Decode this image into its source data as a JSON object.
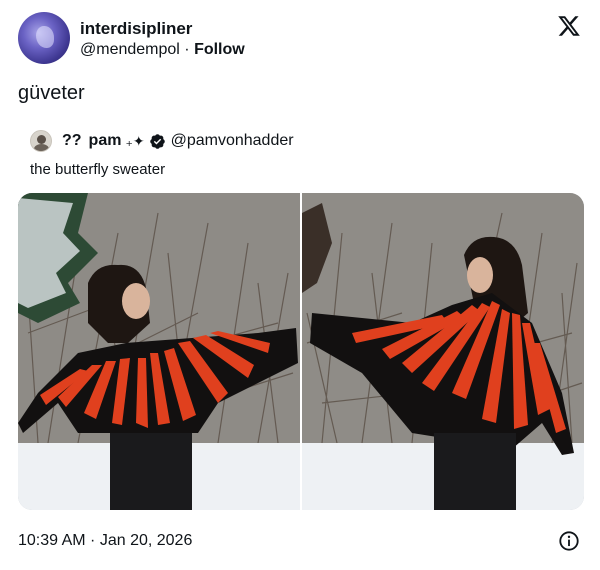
{
  "author": {
    "display_name": "interdisipliner",
    "handle": "@mendempol",
    "separator": " · ",
    "follow_label": "Follow"
  },
  "tweet": {
    "text": "güveter",
    "timestamp": "10:39 AM · Jan 20, 2026"
  },
  "quoted": {
    "name_prefix": "??",
    "name": "pam",
    "name_suffix": "₊✦",
    "handle": "@pamvonhadder",
    "text": "the butterfly sweater",
    "verified": true
  },
  "icons": {
    "logo": "x-logo-icon",
    "info": "info-icon",
    "verified": "verified-badge-icon"
  },
  "colors": {
    "sweater_orange": "#e0401e",
    "sweater_black": "#111111",
    "snow": "#f2f4f7"
  }
}
